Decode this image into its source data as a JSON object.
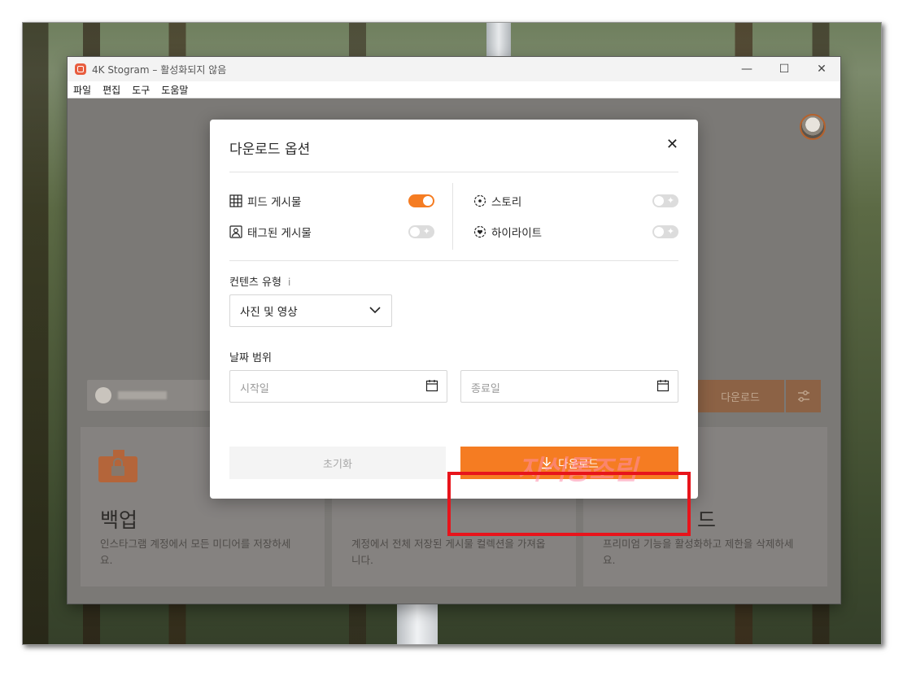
{
  "window": {
    "title": "4K Stogram – 활성화되지 않음",
    "controls": {
      "minimize": "—",
      "maximize": "☐",
      "close": "✕"
    }
  },
  "menu": [
    "파일",
    "편집",
    "도구",
    "도움말"
  ],
  "background": {
    "download_label": "다운로드",
    "cards": [
      {
        "title": "백업",
        "desc": "인스타그램 계정에서 모든 미디어를 저장하세요."
      },
      {
        "title": "",
        "desc": "계정에서 전체 저장된 게시물 컬렉션을 가져옵니다."
      },
      {
        "title": "드",
        "desc": "프리미엄 기능을 활성화하고 제한을 삭제하세요."
      }
    ]
  },
  "modal": {
    "title": "다운로드 옵션",
    "close": "✕",
    "options_left": [
      {
        "icon": "grid-icon",
        "label": "피드 게시물",
        "enabled": true
      },
      {
        "icon": "tagged-person-icon",
        "label": "태그된 게시물",
        "enabled": false
      }
    ],
    "options_right": [
      {
        "icon": "story-circle-icon",
        "label": "스토리",
        "enabled": false
      },
      {
        "icon": "highlight-heart-icon",
        "label": "하이라이트",
        "enabled": false
      }
    ],
    "content_type": {
      "label": "컨텐츠 유형",
      "info": "i",
      "value": "사진 및 영상"
    },
    "date_range": {
      "label": "날짜 범위",
      "start_placeholder": "시작일",
      "end_placeholder": "종료일"
    },
    "reset_label": "초기화",
    "download_label": "다운로드"
  },
  "watermark": "지식통조림",
  "colors": {
    "accent": "#f57c22",
    "highlight": "#e8141b"
  }
}
